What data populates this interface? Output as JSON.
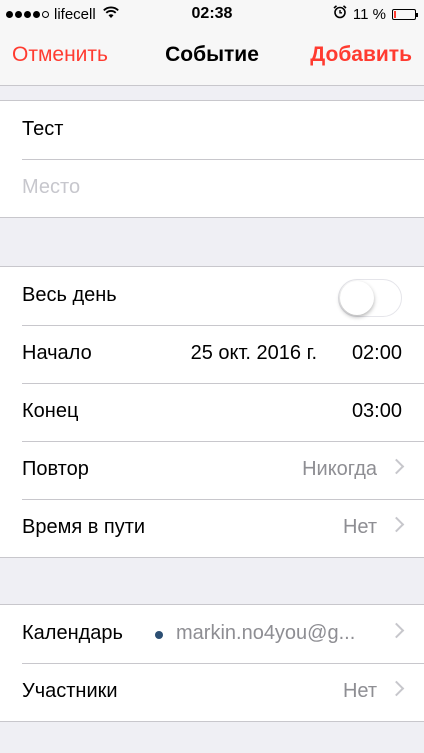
{
  "status_bar": {
    "carrier": "lifecell",
    "time": "02:38",
    "battery_percent": "11 %",
    "battery_level": 0.11,
    "signal_bars": 4,
    "icons": [
      "wifi-icon",
      "alarm-icon",
      "battery-icon"
    ]
  },
  "nav": {
    "cancel_label": "Отменить",
    "title": "Событие",
    "add_label": "Добавить",
    "accent_color": "#ff3b30"
  },
  "event": {
    "title_value": "Тест",
    "location_placeholder": "Место"
  },
  "schedule": {
    "all_day_label": "Весь день",
    "all_day_on": false,
    "start_label": "Начало",
    "start_date": "25 окт. 2016 г.",
    "start_time": "02:00",
    "end_label": "Конец",
    "end_time": "03:00",
    "repeat_label": "Повтор",
    "repeat_value": "Никогда",
    "travel_label": "Время в пути",
    "travel_value": "Нет"
  },
  "calendar": {
    "calendar_label": "Календарь",
    "calendar_value": "markin.no4you@g...",
    "calendar_color": "#2c4f73",
    "invitees_label": "Участники",
    "invitees_value": "Нет"
  }
}
